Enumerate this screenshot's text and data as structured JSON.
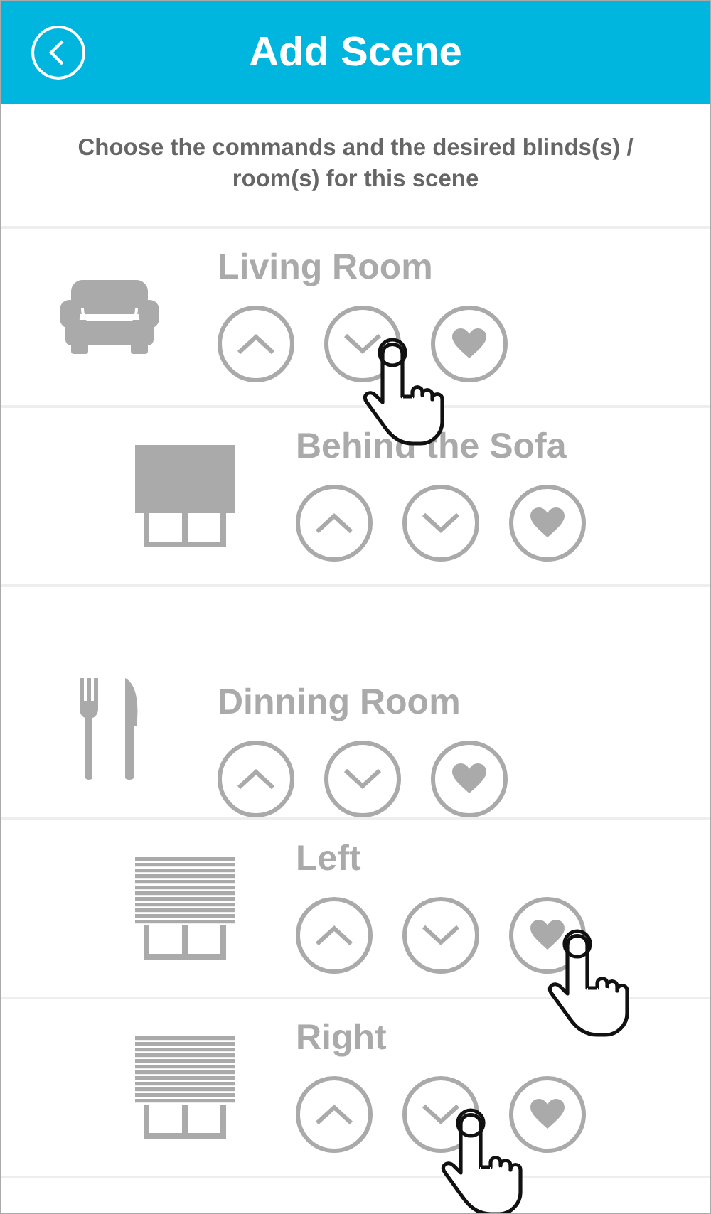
{
  "header": {
    "title": "Add Scene"
  },
  "instructions": "Choose the commands and the desired blinds(s) / room(s) for this scene",
  "items": [
    {
      "kind": "room",
      "name": "Living Room",
      "buttons": [
        {
          "kind": "up",
          "tapped": false
        },
        {
          "kind": "down",
          "tapped": true
        },
        {
          "kind": "favorite",
          "tapped": false
        }
      ]
    },
    {
      "kind": "blind",
      "name": "Behind the Sofa",
      "buttons": [
        {
          "kind": "up",
          "tapped": false
        },
        {
          "kind": "down",
          "tapped": false
        },
        {
          "kind": "favorite",
          "tapped": false
        }
      ]
    },
    {
      "kind": "room",
      "name": "Dinning Room",
      "buttons": [
        {
          "kind": "up",
          "tapped": false
        },
        {
          "kind": "down",
          "tapped": false
        },
        {
          "kind": "favorite",
          "tapped": false
        }
      ]
    },
    {
      "kind": "blind",
      "name": "Left",
      "buttons": [
        {
          "kind": "up",
          "tapped": false
        },
        {
          "kind": "down",
          "tapped": false
        },
        {
          "kind": "favorite",
          "tapped": true
        }
      ]
    },
    {
      "kind": "blind",
      "name": "Right",
      "buttons": [
        {
          "kind": "up",
          "tapped": false
        },
        {
          "kind": "down",
          "tapped": true
        },
        {
          "kind": "favorite",
          "tapped": false
        }
      ]
    }
  ]
}
